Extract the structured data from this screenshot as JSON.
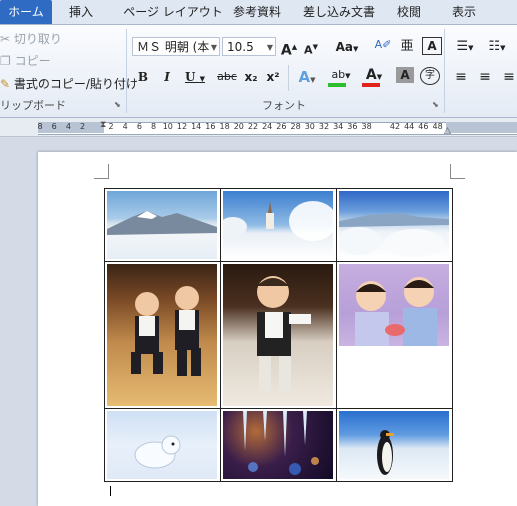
{
  "tabs": [
    "ホーム",
    "挿入",
    "ページ レイアウト",
    "参考資料",
    "差し込み文書",
    "校閲",
    "表示"
  ],
  "clipboard": {
    "cut": "切り取り",
    "copy": "コピー",
    "format_painter": "書式のコピー/貼り付け",
    "group_label": "リップボード"
  },
  "font": {
    "name": "ＭＳ 明朝 (本",
    "size": "10.5",
    "grow": "A",
    "shrink": "A",
    "change_case": "Aa",
    "ruby": "亜",
    "phonetic": "ア",
    "border": "A",
    "bold": "B",
    "italic": "I",
    "underline": "U",
    "strike": "abc",
    "subscript": "x₂",
    "superscript": "x²",
    "effects": "A",
    "highlight": "ab",
    "font_color": "A",
    "char_shading": "A",
    "enclose": "字",
    "group_label": "フォント"
  },
  "ruler": {
    "numbers": [
      "8",
      "6",
      "4",
      "2",
      "",
      "2",
      "4",
      "6",
      "8",
      "10",
      "12",
      "14",
      "16",
      "18",
      "20",
      "22",
      "24",
      "26",
      "28",
      "30",
      "32",
      "34",
      "36",
      "38",
      "",
      "42",
      "44",
      "46",
      "48"
    ]
  },
  "photos": [
    {
      "name": "snowy-mountain-photo",
      "desc": "snow mountain"
    },
    {
      "name": "church-snow-photo",
      "desc": "church"
    },
    {
      "name": "frosted-trees-photo",
      "desc": "frost"
    },
    {
      "name": "toddlers-suits-photo",
      "desc": "twins"
    },
    {
      "name": "toddler-walking-photo",
      "desc": "toddler"
    },
    {
      "name": "kimono-children-photo",
      "desc": "kimono"
    },
    {
      "name": "arctic-fox-photo",
      "desc": "fox"
    },
    {
      "name": "icicles-bokeh-photo",
      "desc": "icicles"
    },
    {
      "name": "penguin-photo",
      "desc": "penguin"
    }
  ],
  "colors": {
    "active_tab": "#2f6bc2",
    "highlight_green": "#2ebd2e",
    "font_red": "#e0231b"
  }
}
